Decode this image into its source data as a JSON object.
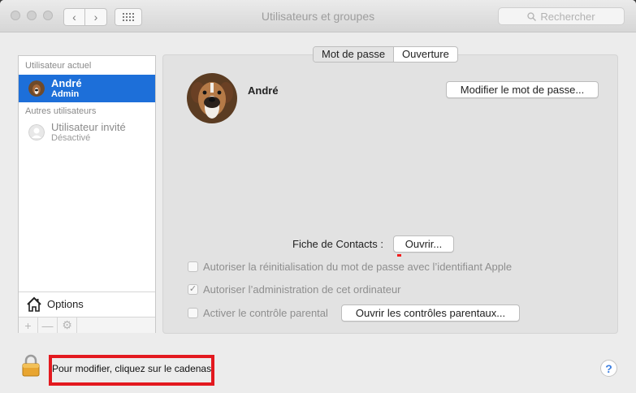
{
  "window": {
    "title": "Utilisateurs et groupes"
  },
  "toolbar": {
    "back_icon": "‹",
    "forward_icon": "›",
    "grid_icon": "grid",
    "search_placeholder": "Rechercher"
  },
  "sidebar": {
    "current_header": "Utilisateur actuel",
    "current_user": {
      "name": "André",
      "role": "Admin"
    },
    "others_header": "Autres utilisateurs",
    "guest_user": {
      "name": "Utilisateur invité",
      "status": "Désactivé"
    },
    "options_label": "Options",
    "add_symbol": "+",
    "remove_symbol": "—",
    "gear_symbol": "⚙"
  },
  "tabs": [
    {
      "label": "Mot de passe",
      "active": true
    },
    {
      "label": "Ouverture",
      "active": false
    }
  ],
  "main": {
    "user_name": "André",
    "change_password_button": "Modifier le mot de passe...",
    "contacts_label": "Fiche de Contacts :",
    "open_button": "Ouvrir...",
    "checkboxes": [
      {
        "label": "Autoriser la réinitialisation du mot de passe avec l’identifiant Apple",
        "checked": false
      },
      {
        "label": "Autoriser l’administration de cet ordinateur",
        "checked": true
      },
      {
        "label": "Activer le contrôle parental",
        "checked": false
      }
    ],
    "parental_button": "Ouvrir les contrôles parentaux..."
  },
  "footer": {
    "lock_text": "Pour modifier, cliquez sur le cadenas",
    "help_symbol": "?"
  },
  "colors": {
    "selection": "#1d6fd9",
    "highlight_box": "#e3191f"
  }
}
